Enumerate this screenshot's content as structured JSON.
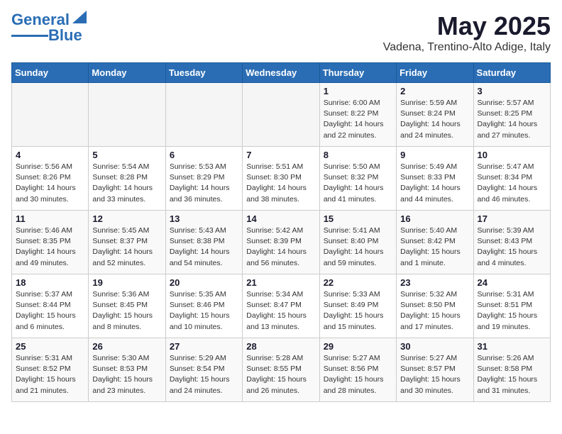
{
  "header": {
    "logo_line1": "General",
    "logo_line2": "Blue",
    "month": "May 2025",
    "location": "Vadena, Trentino-Alto Adige, Italy"
  },
  "weekdays": [
    "Sunday",
    "Monday",
    "Tuesday",
    "Wednesday",
    "Thursday",
    "Friday",
    "Saturday"
  ],
  "weeks": [
    [
      {
        "day": "",
        "info": ""
      },
      {
        "day": "",
        "info": ""
      },
      {
        "day": "",
        "info": ""
      },
      {
        "day": "",
        "info": ""
      },
      {
        "day": "1",
        "info": "Sunrise: 6:00 AM\nSunset: 8:22 PM\nDaylight: 14 hours\nand 22 minutes."
      },
      {
        "day": "2",
        "info": "Sunrise: 5:59 AM\nSunset: 8:24 PM\nDaylight: 14 hours\nand 24 minutes."
      },
      {
        "day": "3",
        "info": "Sunrise: 5:57 AM\nSunset: 8:25 PM\nDaylight: 14 hours\nand 27 minutes."
      }
    ],
    [
      {
        "day": "4",
        "info": "Sunrise: 5:56 AM\nSunset: 8:26 PM\nDaylight: 14 hours\nand 30 minutes."
      },
      {
        "day": "5",
        "info": "Sunrise: 5:54 AM\nSunset: 8:28 PM\nDaylight: 14 hours\nand 33 minutes."
      },
      {
        "day": "6",
        "info": "Sunrise: 5:53 AM\nSunset: 8:29 PM\nDaylight: 14 hours\nand 36 minutes."
      },
      {
        "day": "7",
        "info": "Sunrise: 5:51 AM\nSunset: 8:30 PM\nDaylight: 14 hours\nand 38 minutes."
      },
      {
        "day": "8",
        "info": "Sunrise: 5:50 AM\nSunset: 8:32 PM\nDaylight: 14 hours\nand 41 minutes."
      },
      {
        "day": "9",
        "info": "Sunrise: 5:49 AM\nSunset: 8:33 PM\nDaylight: 14 hours\nand 44 minutes."
      },
      {
        "day": "10",
        "info": "Sunrise: 5:47 AM\nSunset: 8:34 PM\nDaylight: 14 hours\nand 46 minutes."
      }
    ],
    [
      {
        "day": "11",
        "info": "Sunrise: 5:46 AM\nSunset: 8:35 PM\nDaylight: 14 hours\nand 49 minutes."
      },
      {
        "day": "12",
        "info": "Sunrise: 5:45 AM\nSunset: 8:37 PM\nDaylight: 14 hours\nand 52 minutes."
      },
      {
        "day": "13",
        "info": "Sunrise: 5:43 AM\nSunset: 8:38 PM\nDaylight: 14 hours\nand 54 minutes."
      },
      {
        "day": "14",
        "info": "Sunrise: 5:42 AM\nSunset: 8:39 PM\nDaylight: 14 hours\nand 56 minutes."
      },
      {
        "day": "15",
        "info": "Sunrise: 5:41 AM\nSunset: 8:40 PM\nDaylight: 14 hours\nand 59 minutes."
      },
      {
        "day": "16",
        "info": "Sunrise: 5:40 AM\nSunset: 8:42 PM\nDaylight: 15 hours\nand 1 minute."
      },
      {
        "day": "17",
        "info": "Sunrise: 5:39 AM\nSunset: 8:43 PM\nDaylight: 15 hours\nand 4 minutes."
      }
    ],
    [
      {
        "day": "18",
        "info": "Sunrise: 5:37 AM\nSunset: 8:44 PM\nDaylight: 15 hours\nand 6 minutes."
      },
      {
        "day": "19",
        "info": "Sunrise: 5:36 AM\nSunset: 8:45 PM\nDaylight: 15 hours\nand 8 minutes."
      },
      {
        "day": "20",
        "info": "Sunrise: 5:35 AM\nSunset: 8:46 PM\nDaylight: 15 hours\nand 10 minutes."
      },
      {
        "day": "21",
        "info": "Sunrise: 5:34 AM\nSunset: 8:47 PM\nDaylight: 15 hours\nand 13 minutes."
      },
      {
        "day": "22",
        "info": "Sunrise: 5:33 AM\nSunset: 8:49 PM\nDaylight: 15 hours\nand 15 minutes."
      },
      {
        "day": "23",
        "info": "Sunrise: 5:32 AM\nSunset: 8:50 PM\nDaylight: 15 hours\nand 17 minutes."
      },
      {
        "day": "24",
        "info": "Sunrise: 5:31 AM\nSunset: 8:51 PM\nDaylight: 15 hours\nand 19 minutes."
      }
    ],
    [
      {
        "day": "25",
        "info": "Sunrise: 5:31 AM\nSunset: 8:52 PM\nDaylight: 15 hours\nand 21 minutes."
      },
      {
        "day": "26",
        "info": "Sunrise: 5:30 AM\nSunset: 8:53 PM\nDaylight: 15 hours\nand 23 minutes."
      },
      {
        "day": "27",
        "info": "Sunrise: 5:29 AM\nSunset: 8:54 PM\nDaylight: 15 hours\nand 24 minutes."
      },
      {
        "day": "28",
        "info": "Sunrise: 5:28 AM\nSunset: 8:55 PM\nDaylight: 15 hours\nand 26 minutes."
      },
      {
        "day": "29",
        "info": "Sunrise: 5:27 AM\nSunset: 8:56 PM\nDaylight: 15 hours\nand 28 minutes."
      },
      {
        "day": "30",
        "info": "Sunrise: 5:27 AM\nSunset: 8:57 PM\nDaylight: 15 hours\nand 30 minutes."
      },
      {
        "day": "31",
        "info": "Sunrise: 5:26 AM\nSunset: 8:58 PM\nDaylight: 15 hours\nand 31 minutes."
      }
    ]
  ]
}
